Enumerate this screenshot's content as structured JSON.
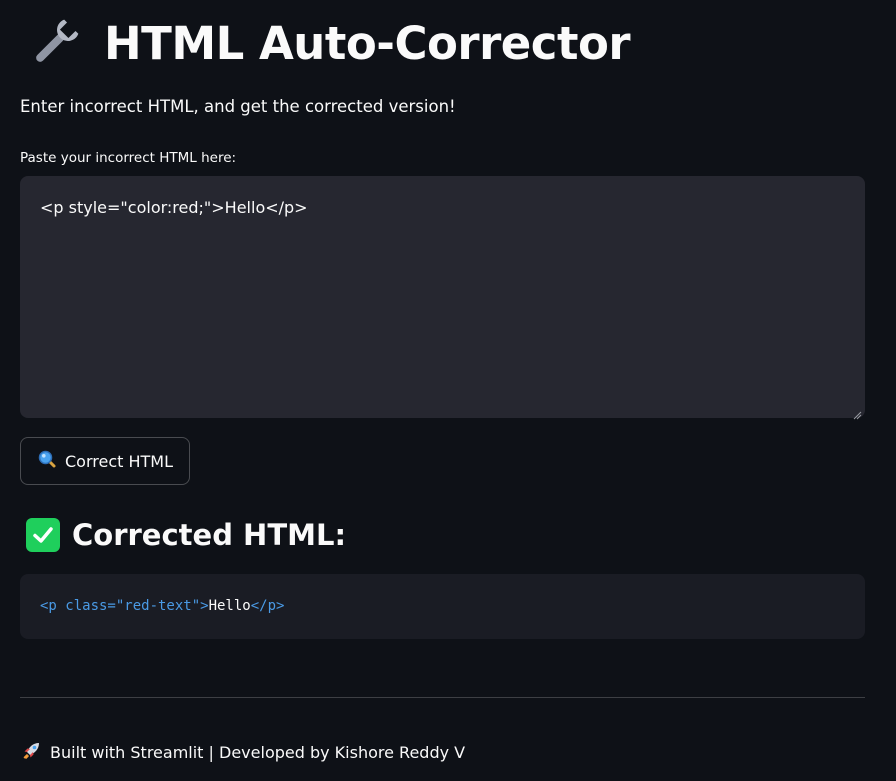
{
  "header": {
    "title": "HTML Auto-Corrector",
    "icon": "wrench-icon"
  },
  "subtitle": "Enter incorrect HTML, and get the corrected version!",
  "input": {
    "label": "Paste your incorrect HTML here:",
    "value": "<p style=\"color:red;\">Hello</p>"
  },
  "button": {
    "icon": "magnifier-icon",
    "label": "Correct HTML"
  },
  "result": {
    "icon": "check-mark-icon",
    "heading": "Corrected HTML:",
    "code": {
      "tag_open": "<p class=\"red-text\">",
      "text": "Hello",
      "tag_close": "</p>"
    }
  },
  "footer": {
    "icon": "rocket-icon",
    "text": "Built with Streamlit | Developed by Kishore Reddy V"
  },
  "colors": {
    "background": "#0e1117",
    "input_bg": "#262730",
    "code_bg": "#1a1c24",
    "accent_green": "#1fcf5c",
    "code_tag": "#4a9ae5"
  }
}
